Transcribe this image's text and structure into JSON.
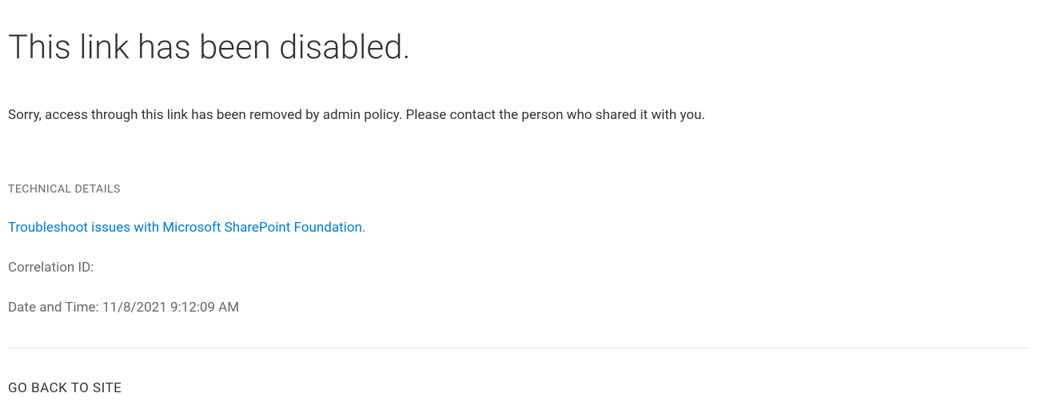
{
  "title": "This link has been disabled.",
  "message": "Sorry, access through this link has been removed by admin policy. Please contact the person who shared it with you.",
  "technical": {
    "header": "TECHNICAL DETAILS",
    "troubleshoot_link": "Troubleshoot issues with Microsoft SharePoint Foundation.",
    "correlation_label": "Correlation ID:",
    "datetime_label": "Date and Time: 11/8/2021 9:12:09 AM"
  },
  "footer": {
    "go_back": "GO BACK TO SITE"
  }
}
